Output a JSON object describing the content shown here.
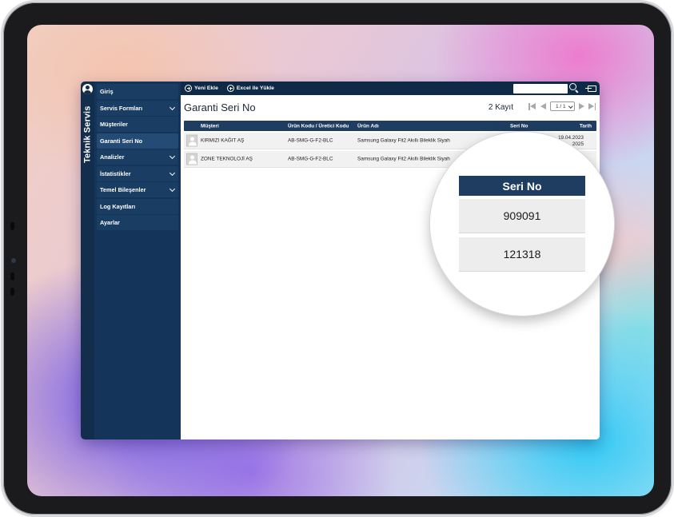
{
  "brand": "Teknik Servis",
  "sidebar": {
    "items": [
      {
        "label": "Giriş"
      },
      {
        "label": "Servis Formları"
      },
      {
        "label": "Müşteriler"
      },
      {
        "label": "Garanti Seri No"
      },
      {
        "label": "Analizler"
      },
      {
        "label": "İstatistikler"
      },
      {
        "label": "Temel Bileşenler"
      },
      {
        "label": "Log Kayıtları"
      },
      {
        "label": "Ayarlar"
      }
    ],
    "active": "Garanti Seri No"
  },
  "toolbar": {
    "new_label": "Yeni Ekle",
    "excel_label": "Excel ile Yükle"
  },
  "page": {
    "title": "Garanti Seri No",
    "record_count": "2 Kayıt",
    "pager_value": "1 / 1"
  },
  "table": {
    "headers": {
      "customer": "Müşteri",
      "code": "Ürün Kodu / Üretici Kodu",
      "product": "Ürün Adı",
      "serial": "Seri No",
      "date": "Tarih"
    },
    "rows": [
      {
        "customer": "KIRMIZI KAĞIT AŞ",
        "code": "AB-SMG-G-F2-BLC",
        "product": "Samsung Galaxy Fit2 Akıllı Bileklik Siyah",
        "date_line1": "19.04.2023",
        "date_line2": "2025"
      },
      {
        "customer": "ZONE TEKNOLOJİ AŞ",
        "code": "AB-SMG-G-F2-BLC",
        "product": "Samsung Galaxy Fit2 Akıllı Bileklik Siyah"
      }
    ]
  },
  "magnifier": {
    "header": "Seri No",
    "values": [
      "909091",
      "121318"
    ]
  },
  "colors": {
    "sidebar": "#15345a",
    "topbar": "#0e2a47",
    "table_header": "#1f3d60"
  }
}
